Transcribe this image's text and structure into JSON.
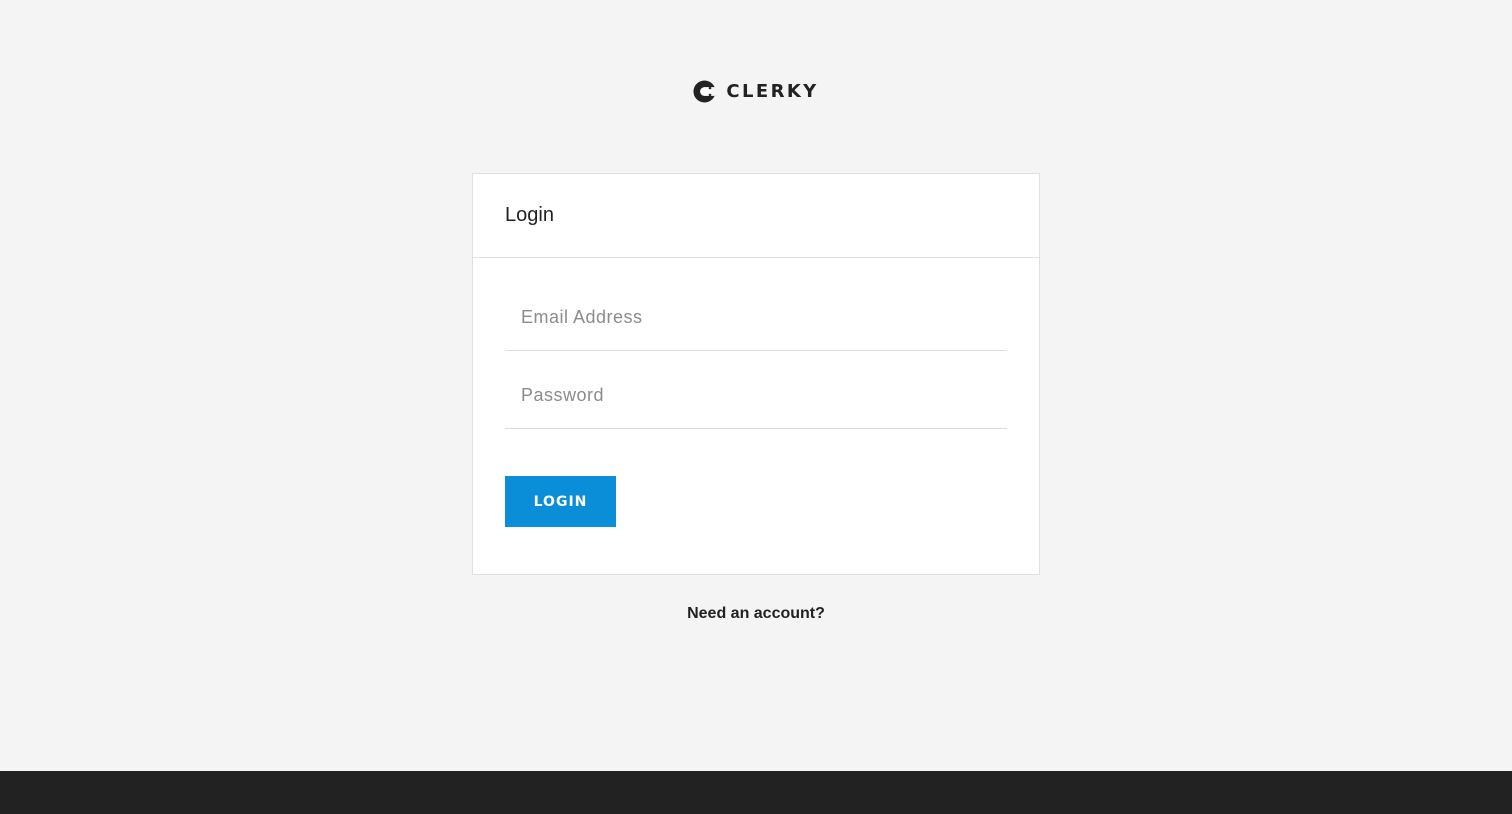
{
  "brand": {
    "name": "CLERKY",
    "logo_icon": "clerky-c-logo-icon"
  },
  "login_card": {
    "title": "Login",
    "email_placeholder": "Email Address",
    "password_placeholder": "Password",
    "submit_label": "LOGIN"
  },
  "signup_link": {
    "label": "Need an account?"
  },
  "colors": {
    "background": "#f4f4f4",
    "card_background": "#ffffff",
    "accent_button": "#0b8ed8",
    "text": "#222222",
    "placeholder": "#8c8c8c",
    "footer": "#222222"
  }
}
